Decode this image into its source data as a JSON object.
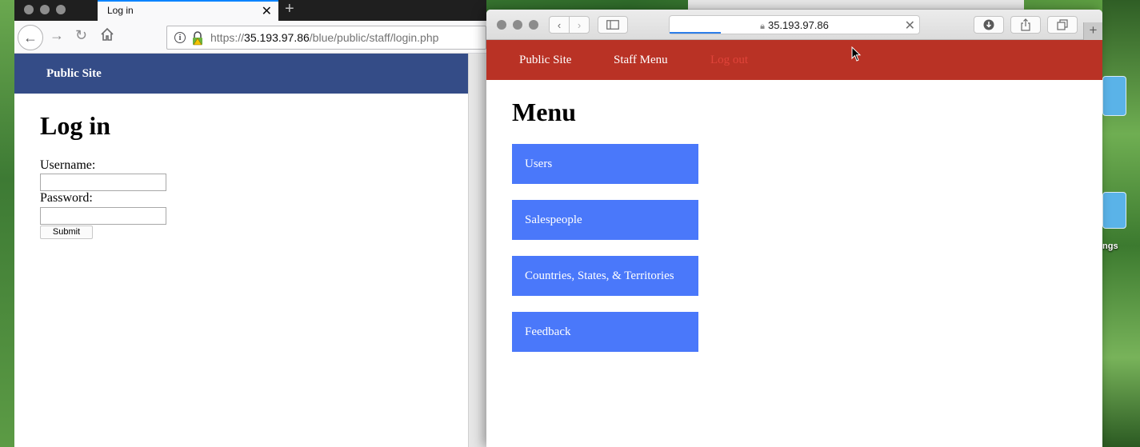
{
  "firefox": {
    "tab_title": "Log in",
    "url_prefix": "https://",
    "url_host": "35.193.97.86",
    "url_path": "/blue/public/staff/login.php",
    "page": {
      "nav_public_site": "Public Site",
      "heading": "Log in",
      "username_label": "Username:",
      "password_label": "Password:",
      "submit_label": "Submit",
      "header_color": "#344c87"
    }
  },
  "safari": {
    "url": "35.193.97.86",
    "page": {
      "header_color": "#b93225",
      "nav": {
        "public_site": "Public Site",
        "staff_menu": "Staff Menu",
        "log_out": "Log out"
      },
      "heading": "Menu",
      "menu_items": [
        "Users",
        "Salespeople",
        "Countries, States, & Territories",
        "Feedback"
      ],
      "menu_button_color": "#4a78fa"
    }
  },
  "desktop": {
    "partial_label": "ngs"
  }
}
